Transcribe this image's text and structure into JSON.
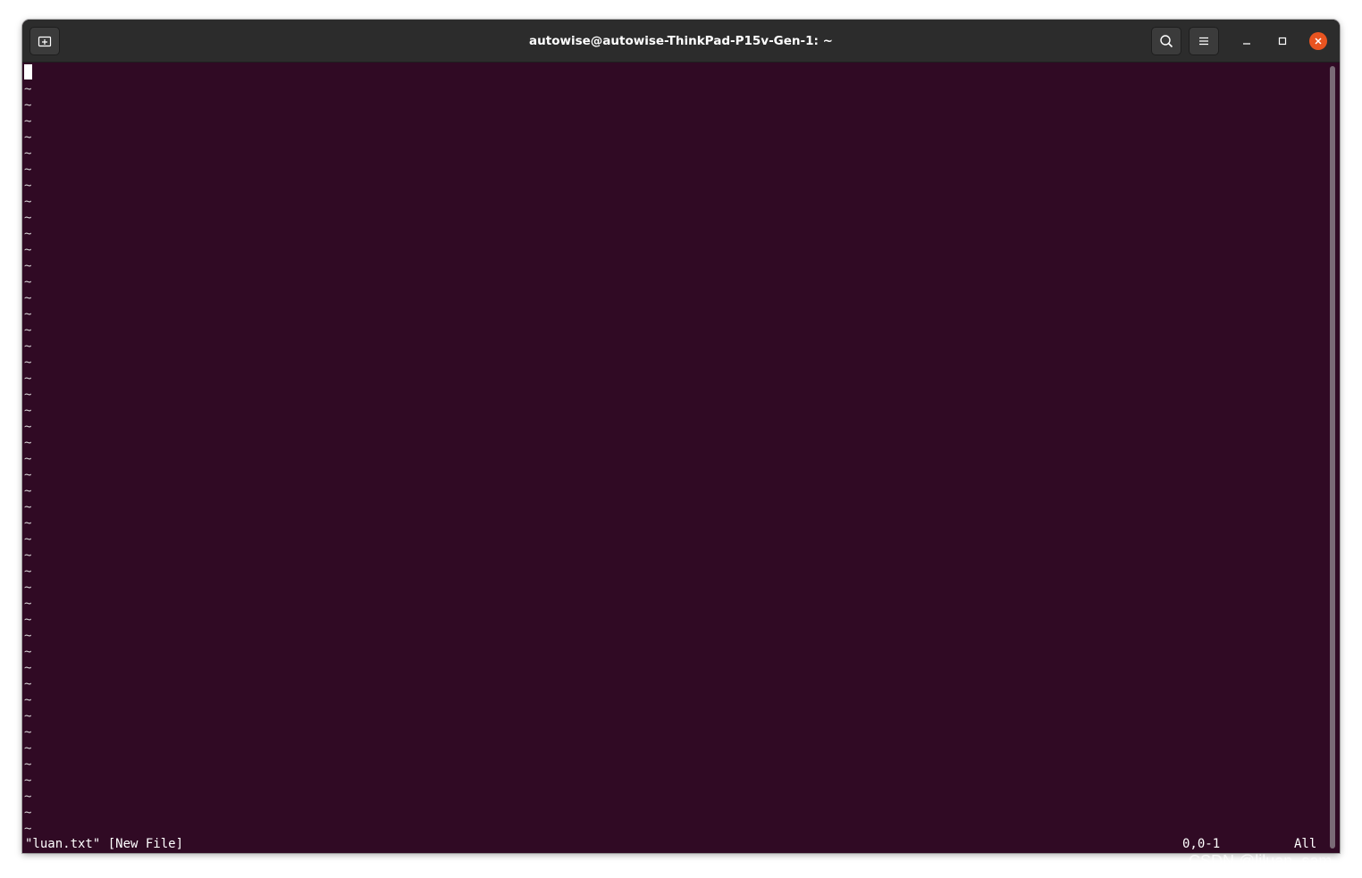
{
  "window": {
    "title": "autowise@autowise-ThinkPad-P15v-Gen-1: ~"
  },
  "editor": {
    "tilde": "~",
    "empty_line_count": 47,
    "status_message": "\"luan.txt\" [New File]",
    "cursor_position": "0,0-1",
    "scroll_position": "All"
  },
  "watermark": "CSDN @liluan_sam",
  "colors": {
    "terminal_bg": "#300a24",
    "titlebar_bg": "#2c2c2c",
    "close_button": "#e95420"
  },
  "icons": {
    "new_tab": "new-tab-icon",
    "search": "search-icon",
    "menu": "hamburger-menu-icon",
    "minimize": "minimize-icon",
    "maximize": "maximize-icon",
    "close": "close-icon"
  }
}
